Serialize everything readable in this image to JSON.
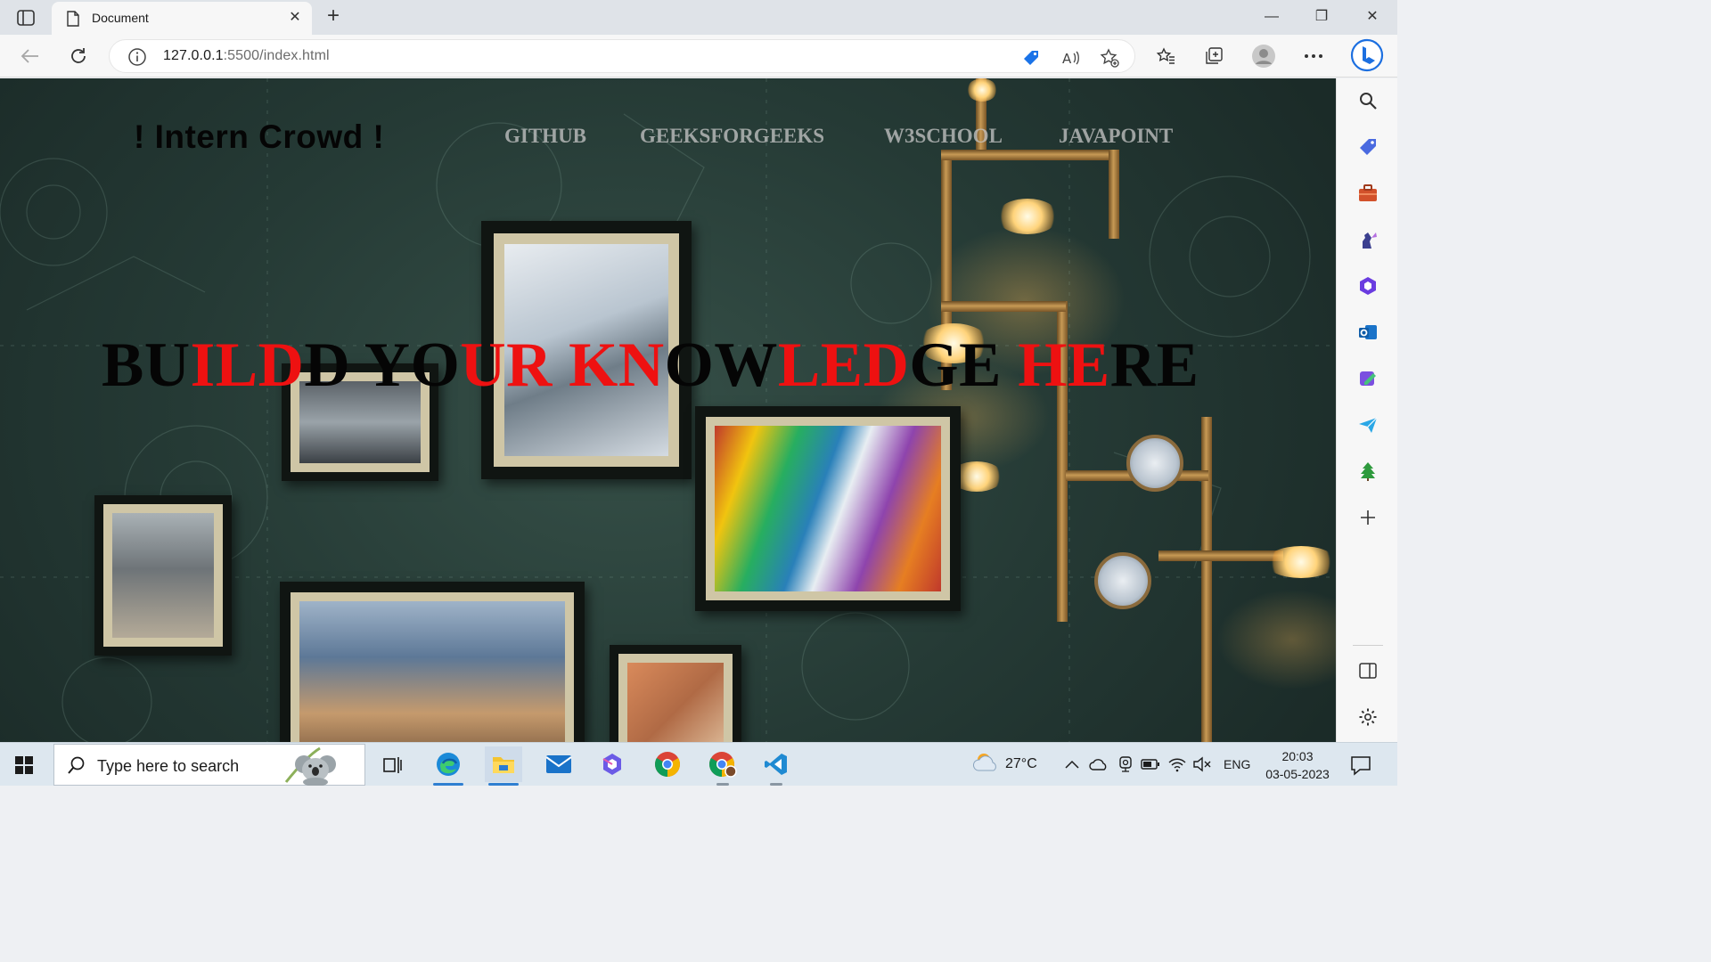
{
  "browser": {
    "tab": {
      "title": "Document",
      "close_glyph": "✕"
    },
    "new_tab_glyph": "+",
    "window_controls": {
      "minimize": "—",
      "restore": "❐",
      "close": "✕"
    },
    "address": {
      "host": "127.0.0.1",
      "path": ":5500/index.html"
    },
    "toolbar_icons": [
      "back-icon",
      "refresh-icon",
      "info-icon",
      "coupon-icon",
      "read-aloud-icon",
      "add-favorite-icon",
      "favorites-icon",
      "collections-icon",
      "profile-icon",
      "more-icon",
      "bing-icon"
    ],
    "sidebar_icons": [
      "search-icon",
      "shopping-icon",
      "tools-icon",
      "games-icon",
      "office-icon",
      "outlook-icon",
      "designer-icon",
      "send-icon",
      "tree-icon",
      "add-icon",
      "split-screen-icon",
      "settings-icon"
    ]
  },
  "page": {
    "brand": "! Intern Crowd !",
    "nav": [
      "GITHUB",
      "GEEKSFORGEEKS",
      "W3SCHOOL",
      "JAVAPOINT"
    ],
    "hero_parts": [
      {
        "text": "BU",
        "color": "black"
      },
      {
        "text": "ILD",
        "color": "red"
      },
      {
        "text": " D",
        "color": "black"
      },
      {
        "text": " YO",
        "color": "black"
      },
      {
        "text": "UR KN",
        "color": "red"
      },
      {
        "text": "OW",
        "color": "black"
      },
      {
        "text": "LED",
        "color": "red"
      },
      {
        "text": "GE",
        "color": "black"
      },
      {
        "text": " HE",
        "color": "red"
      },
      {
        "text": "RE",
        "color": "black"
      }
    ],
    "colors": {
      "hero_black": "#050505",
      "hero_red": "#ee1111",
      "nav": "#c8c8c8"
    }
  },
  "taskbar": {
    "search_placeholder": "Type here to search",
    "apps": [
      "task-view-icon",
      "edge-icon",
      "file-explorer-icon",
      "mail-icon",
      "copilot-icon",
      "chrome-icon",
      "chrome-profile-icon",
      "vscode-icon"
    ],
    "weather": {
      "temp": "27°C"
    },
    "language": "ENG",
    "clock": {
      "time": "20:03",
      "date": "03-05-2023"
    }
  }
}
